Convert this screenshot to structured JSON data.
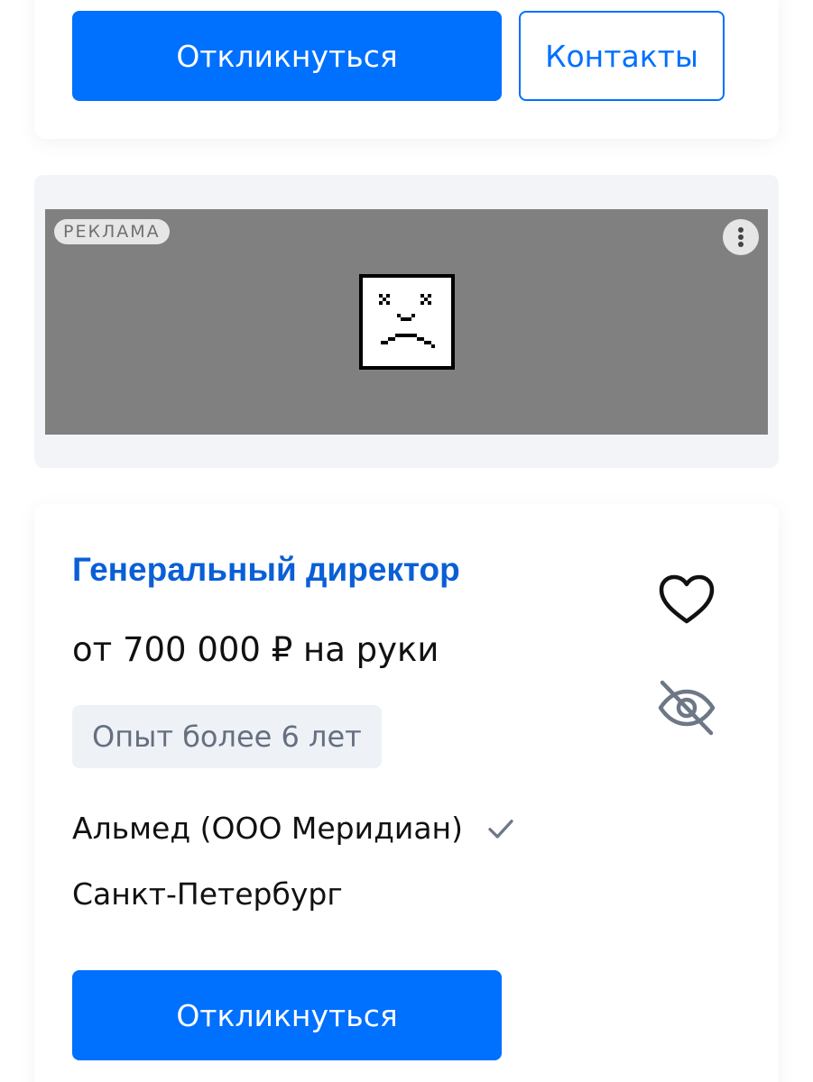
{
  "top_card": {
    "respond_label": "Откликнуться",
    "contacts_label": "Контакты"
  },
  "ad": {
    "badge": "РЕКЛАМА",
    "menu_icon": "more-vertical-icon",
    "error_icon": "broken-ad-icon"
  },
  "vacancy": {
    "title": "Генеральный директор",
    "salary": "от 700 000 ₽ на руки",
    "experience": "Опыт более 6 лет",
    "company": "Альмед (ООО Меридиан)",
    "company_verified_icon": "checkmark-icon",
    "city": "Санкт-Петербург",
    "favorite_icon": "heart-icon",
    "hide_icon": "eye-off-icon",
    "respond_label": "Откликнуться"
  },
  "colors": {
    "accent": "#0070ff",
    "title_blue": "#0a5fd6",
    "chip_bg": "#eef1f6",
    "ad_bg": "#808080"
  }
}
